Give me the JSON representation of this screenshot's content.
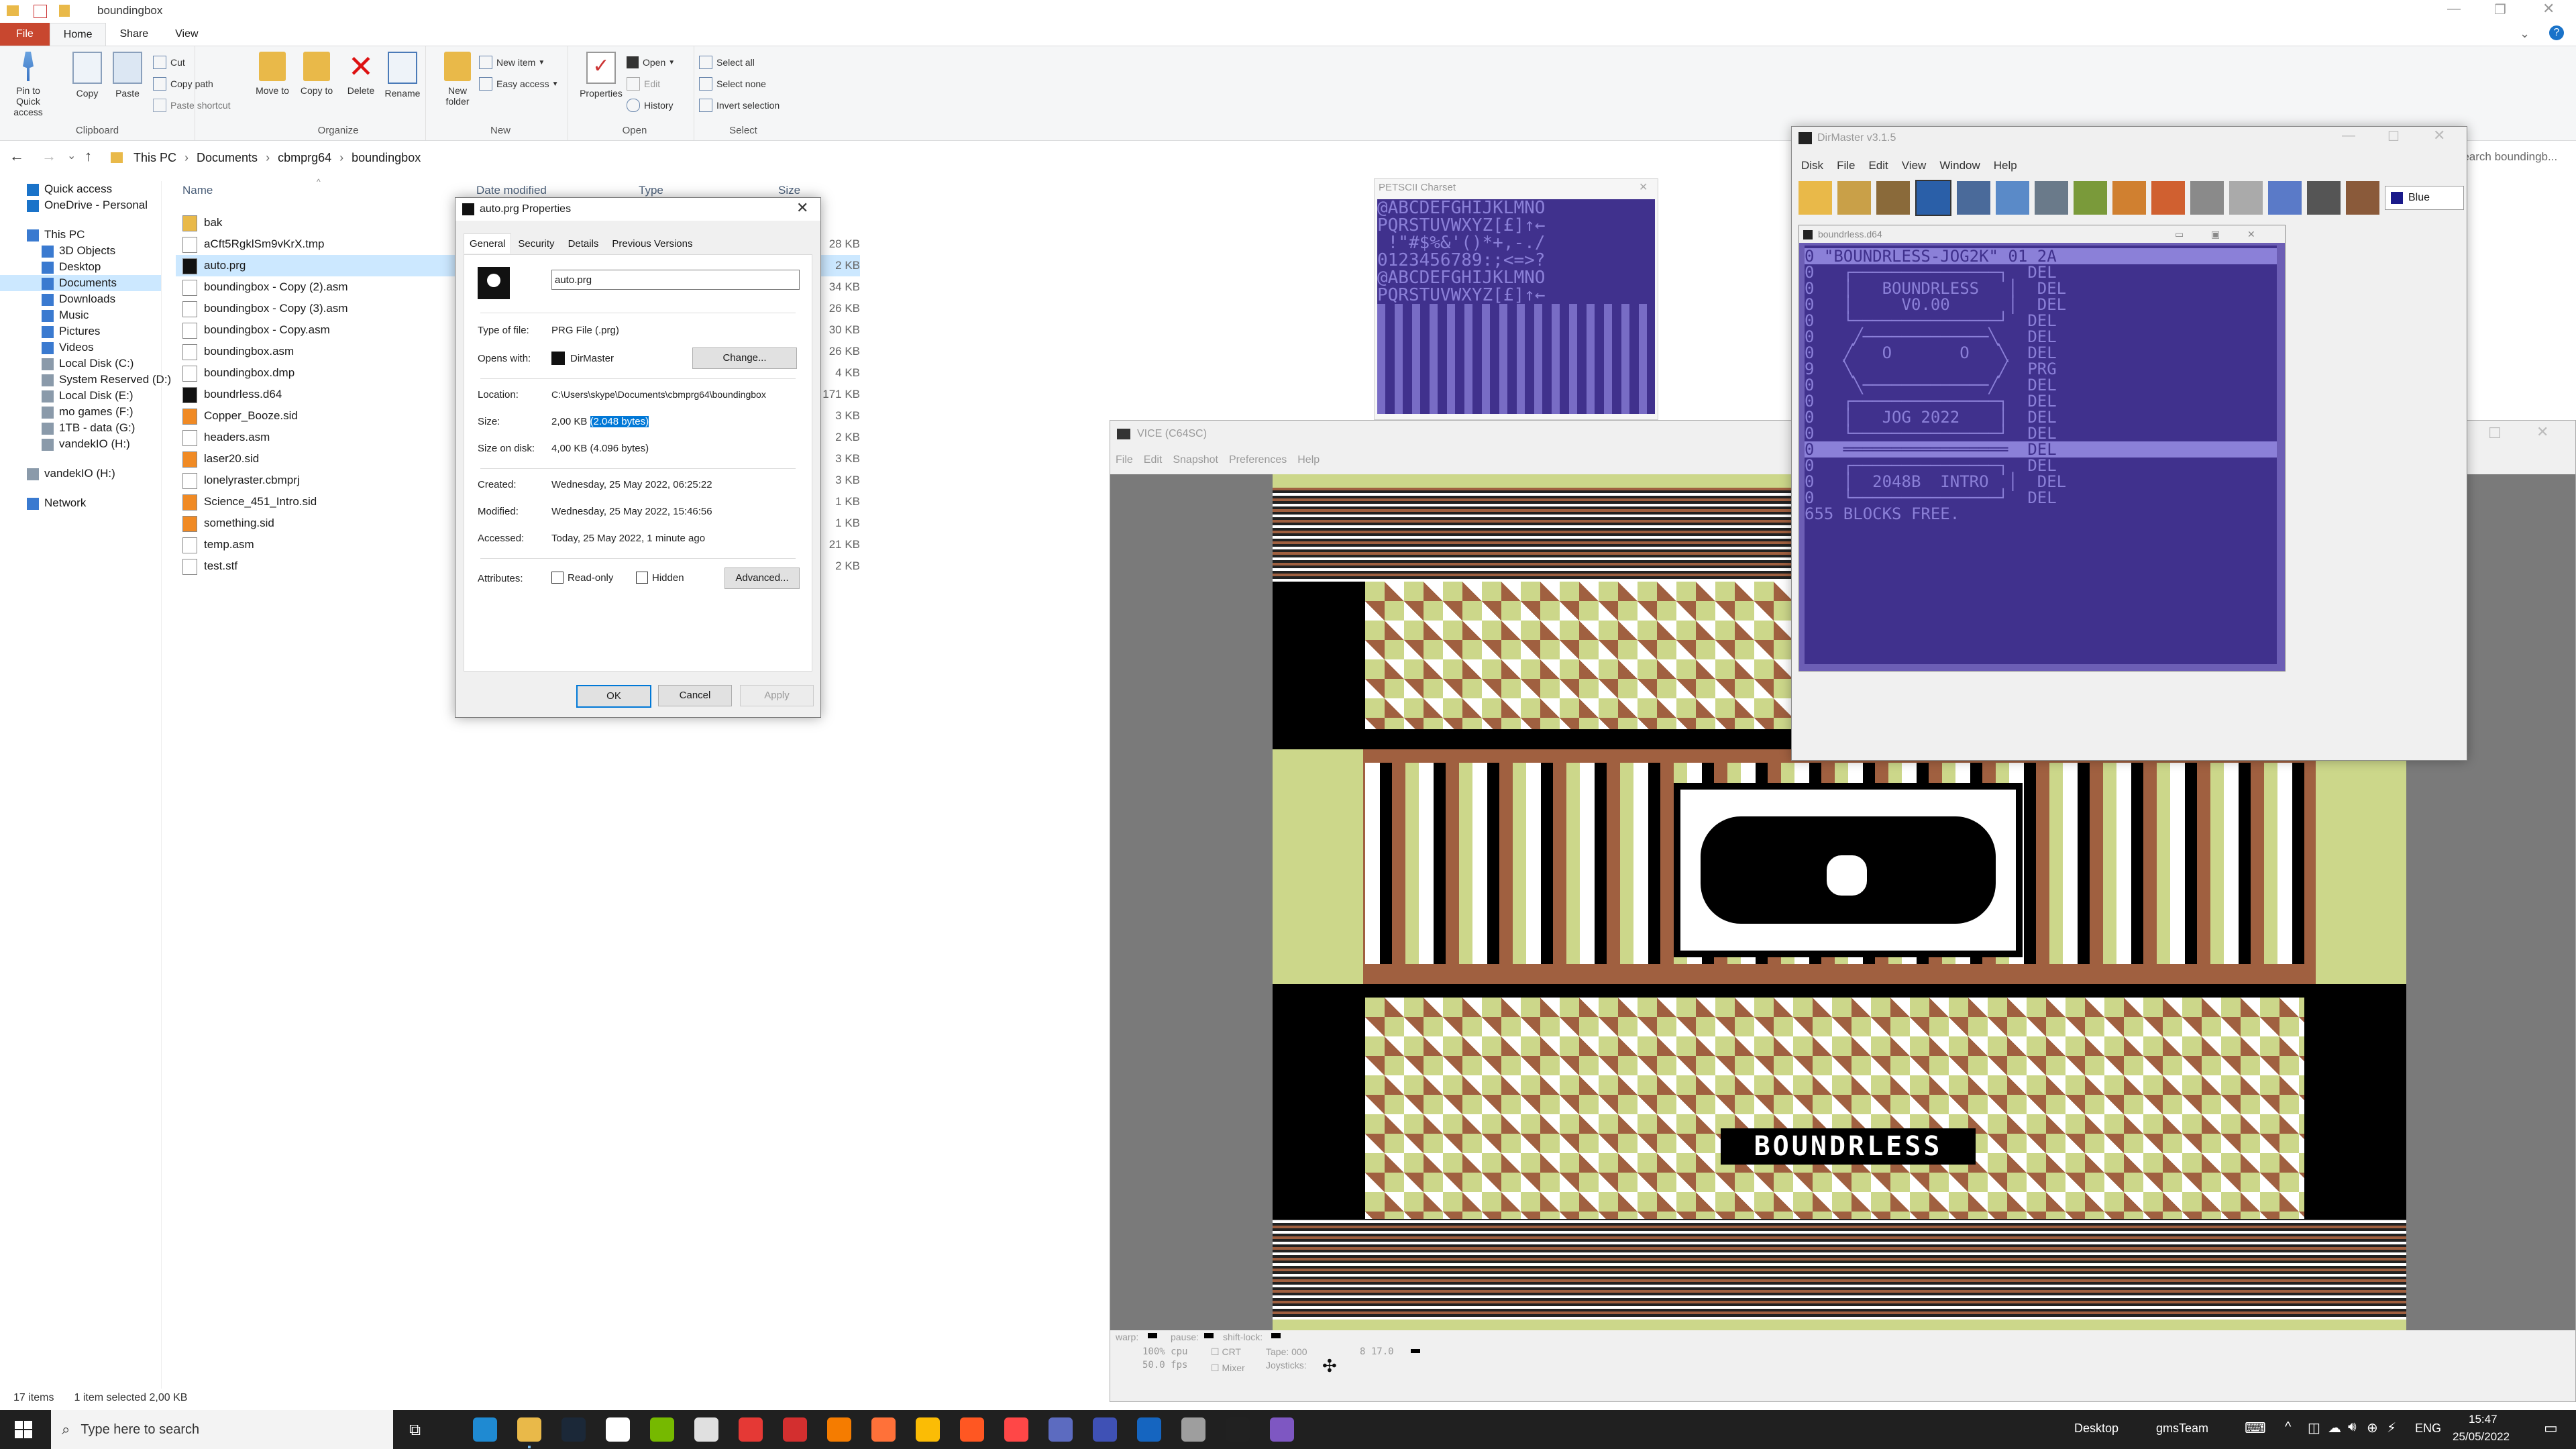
{
  "explorer": {
    "title": "boundingbox",
    "ribbon_tabs": [
      "File",
      "Home",
      "Share",
      "View"
    ],
    "ribbon": {
      "clipboard": {
        "label": "Clipboard",
        "pin": "Pin to Quick access",
        "copy": "Copy",
        "paste": "Paste",
        "cut": "Cut",
        "copy_path": "Copy path",
        "paste_shortcut": "Paste shortcut"
      },
      "organize": {
        "label": "Organize",
        "move": "Move to",
        "copy_to": "Copy to",
        "delete": "Delete",
        "rename": "Rename"
      },
      "new": {
        "label": "New",
        "new_folder": "New folder",
        "new_item": "New item",
        "easy_access": "Easy access"
      },
      "open": {
        "label": "Open",
        "properties": "Properties",
        "open": "Open",
        "edit": "Edit",
        "history": "History"
      },
      "select": {
        "label": "Select",
        "select_all": "Select all",
        "select_none": "Select none",
        "invert": "Invert selection"
      }
    },
    "address": [
      "This PC",
      "Documents",
      "cbmprg64",
      "boundingbox"
    ],
    "search_placeholder": "Search boundingb...",
    "nav": [
      {
        "label": "Quick access",
        "icon": "star-icon"
      },
      {
        "label": "OneDrive - Personal",
        "icon": "cloud-icon"
      },
      {
        "label": "This PC",
        "icon": "pc-icon"
      },
      {
        "label": "3D Objects",
        "icon": "cube-icon"
      },
      {
        "label": "Desktop",
        "icon": "desktop-icon"
      },
      {
        "label": "Documents",
        "icon": "documents-icon"
      },
      {
        "label": "Downloads",
        "icon": "download-icon"
      },
      {
        "label": "Music",
        "icon": "music-icon"
      },
      {
        "label": "Pictures",
        "icon": "pictures-icon"
      },
      {
        "label": "Videos",
        "icon": "videos-icon"
      },
      {
        "label": "Local Disk (C:)",
        "icon": "drive-icon"
      },
      {
        "label": "System Reserved (D:)",
        "icon": "drive-icon"
      },
      {
        "label": "Local Disk (E:)",
        "icon": "drive-icon"
      },
      {
        "label": "mo games (F:)",
        "icon": "drive-icon"
      },
      {
        "label": "1TB - data (G:)",
        "icon": "drive-icon"
      },
      {
        "label": "vandekIO (H:)",
        "icon": "drive-icon"
      },
      {
        "label": "vandekIO (H:)",
        "icon": "drive-icon"
      },
      {
        "label": "Network",
        "icon": "network-icon"
      }
    ],
    "columns": {
      "name": "Name",
      "date": "Date modified",
      "type": "Type",
      "size": "Size"
    },
    "files": [
      {
        "name": "bak",
        "size": "",
        "icon": "folder-icon"
      },
      {
        "name": "aCft5RgklSm9vKrX.tmp",
        "size": "28 KB",
        "icon": "file-icon"
      },
      {
        "name": "auto.prg",
        "size": "2 KB",
        "icon": "prg-icon"
      },
      {
        "name": "boundingbox - Copy (2).asm",
        "size": "34 KB",
        "icon": "file-icon"
      },
      {
        "name": "boundingbox - Copy (3).asm",
        "size": "26 KB",
        "icon": "file-icon"
      },
      {
        "name": "boundingbox - Copy.asm",
        "size": "30 KB",
        "icon": "file-icon"
      },
      {
        "name": "boundingbox.asm",
        "size": "26 KB",
        "icon": "file-icon"
      },
      {
        "name": "boundingbox.dmp",
        "size": "4 KB",
        "icon": "file-icon"
      },
      {
        "name": "boundrless.d64",
        "size": "171 KB",
        "icon": "prg-icon"
      },
      {
        "name": "Copper_Booze.sid",
        "size": "3 KB",
        "icon": "sid-icon"
      },
      {
        "name": "headers.asm",
        "size": "2 KB",
        "icon": "file-icon"
      },
      {
        "name": "laser20.sid",
        "size": "3 KB",
        "icon": "sid-icon"
      },
      {
        "name": "lonelyraster.cbmprj",
        "size": "3 KB",
        "icon": "file-icon"
      },
      {
        "name": "Science_451_Intro.sid",
        "size": "1 KB",
        "icon": "sid-icon"
      },
      {
        "name": "something.sid",
        "size": "1 KB",
        "icon": "sid-icon"
      },
      {
        "name": "temp.asm",
        "size": "21 KB",
        "icon": "file-icon"
      },
      {
        "name": "test.stf",
        "size": "2 KB",
        "icon": "file-icon"
      }
    ],
    "status": {
      "count": "17 items",
      "selected": "1 item selected  2,00 KB"
    }
  },
  "props": {
    "title": "auto.prg Properties",
    "tabs": [
      "General",
      "Security",
      "Details",
      "Previous Versions"
    ],
    "filename": "auto.prg",
    "type_label": "Type of file:",
    "type_value": "PRG File (.prg)",
    "opens_label": "Opens with:",
    "opens_value": "DirMaster",
    "change": "Change...",
    "location_label": "Location:",
    "location_value": "C:\\Users\\skype\\Documents\\cbmprg64\\boundingbox",
    "size_label": "Size:",
    "size_value": "2,00 KB",
    "size_bytes": "(2.048 bytes)",
    "disk_label": "Size on disk:",
    "disk_value": "4,00 KB (4.096 bytes)",
    "created_label": "Created:",
    "created_value": "Wednesday, 25 May 2022, 06:25:22",
    "modified_label": "Modified:",
    "modified_value": "Wednesday, 25 May 2022, 15:46:56",
    "accessed_label": "Accessed:",
    "accessed_value": "Today, 25 May 2022, 1 minute ago",
    "attributes_label": "Attributes:",
    "readonly": "Read-only",
    "hidden": "Hidden",
    "advanced": "Advanced...",
    "ok": "OK",
    "cancel": "Cancel",
    "apply": "Apply"
  },
  "petscii": {
    "title": "PETSCII Charset",
    "rows": [
      "@ABCDEFGHIJKLMNO",
      "PQRSTUVWXYZ[£]↑←",
      " !\"#$%&'()*+,-./",
      "0123456789:;<=>?",
      "@ABCDEFGHIJKLMNO",
      "PQRSTUVWXYZ[£]↑←"
    ]
  },
  "vice": {
    "title": "VICE (C64SC)",
    "menu": [
      "File",
      "Edit",
      "Snapshot",
      "Preferences",
      "Help"
    ],
    "logo_text": "BOUNDRLESS",
    "status": {
      "warp": "warp:",
      "pause": "pause:",
      "shift": "shift-lock:",
      "cpu": "100% cpu",
      "fps": "50.0 fps",
      "crt": "CRT",
      "mixer": "Mixer",
      "tape": "Tape: 000",
      "joy": "Joysticks:",
      "drive": "8 17.0"
    }
  },
  "dirmaster": {
    "title": "DirMaster v3.1.5",
    "menu": [
      "Disk",
      "File",
      "Edit",
      "View",
      "Window",
      "Help"
    ],
    "palette": "Blue",
    "d64_title": "boundrless.d64",
    "rows": [
      "0 \"BOUNDRLESS-JOG2K\" 01 2A",
      "0   ┌───────────────┐  DEL",
      "0   │   BOUNDRLESS   │  DEL",
      "0   │     V0.00      │  DEL",
      "0   └───────────────┘  DEL",
      "0    ╱─────────────╲   DEL",
      "0   ╱   O       O   ╲  DEL",
      "9   ╲               ╱  PRG",
      "0    ╲─────────────╱   DEL",
      "0   ┌───────────────┐  DEL",
      "0   │   JOG 2022    │  DEL",
      "0   └───────────────┘  DEL",
      "0   ═════════════════  DEL",
      "0   ┌───────────────┐  DEL",
      "0   │  2048B  INTRO  │  DEL",
      "0   └───────────────┘  DEL",
      "655 BLOCKS FREE."
    ]
  },
  "taskbar": {
    "search_placeholder": "Type here to search",
    "desktop": "Desktop",
    "team": "gmsTeam",
    "lang": "ENG",
    "time": "15:47",
    "date": "25/05/2022",
    "apps": [
      "edge-icon",
      "explorer-icon",
      "steam-icon",
      "notepad-icon",
      "nvidia-icon",
      "app-icon",
      "app-icon",
      "app-icon",
      "vlc-icon",
      "firefox-icon",
      "chrome-icon",
      "app-icon",
      "ea-icon",
      "calculator-icon",
      "vice-icon",
      "app-icon",
      "c64-icon",
      "dirmaster-icon",
      "app-icon"
    ]
  },
  "colors": {
    "accent": "#0078d7",
    "file_tab": "#c8472f",
    "c64_bg": "#40318d",
    "c64_fg": "#8b80d8",
    "selection": "#cce8ff"
  }
}
